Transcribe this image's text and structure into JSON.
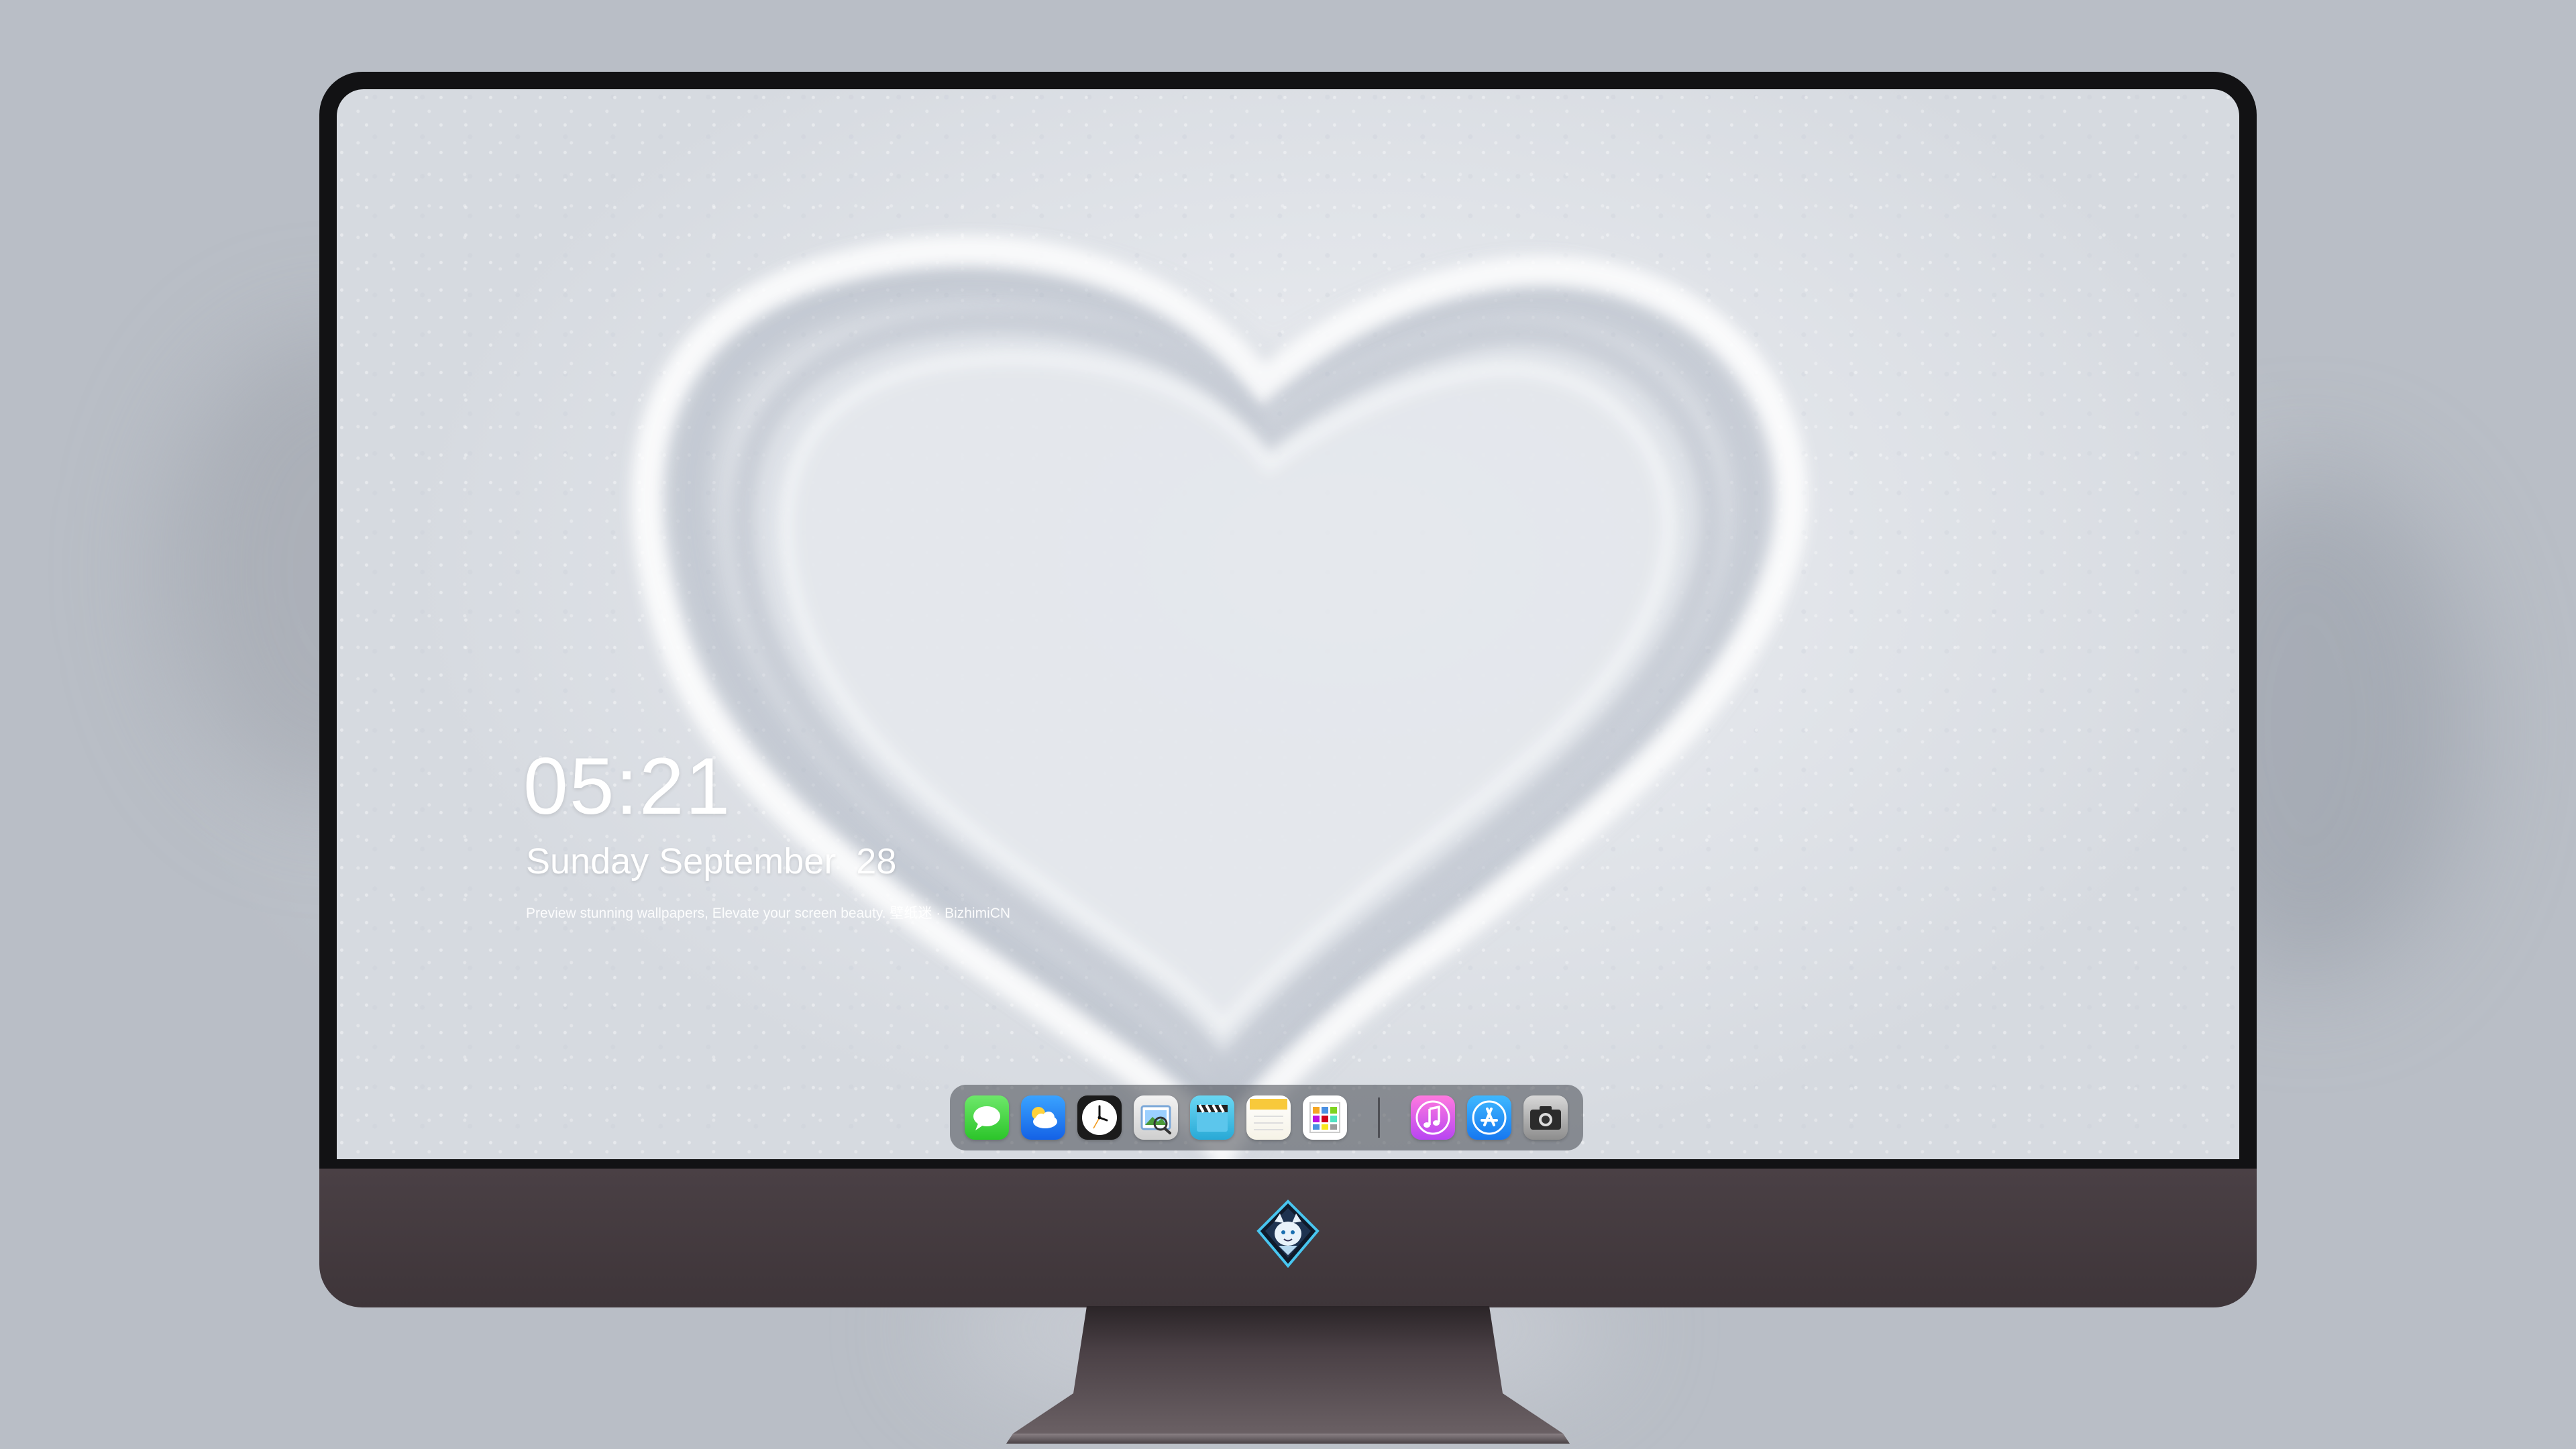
{
  "lockscreen": {
    "time": "05:21",
    "date": "Sunday September  28",
    "tagline": "Preview stunning wallpapers, Elevate your screen beauty. 壁纸迷 · BizhimiCN"
  },
  "dock": {
    "apps": [
      {
        "name": "Messages",
        "icon": "messages-icon"
      },
      {
        "name": "Weather",
        "icon": "weather-icon"
      },
      {
        "name": "Clock",
        "icon": "clock-icon"
      },
      {
        "name": "Preview",
        "icon": "preview-icon"
      },
      {
        "name": "Clips",
        "icon": "clapperboard-icon"
      },
      {
        "name": "Notes",
        "icon": "notes-icon"
      },
      {
        "name": "Calendar",
        "icon": "calendar-icon"
      },
      {
        "name": "Music",
        "icon": "music-note-icon"
      },
      {
        "name": "App Store",
        "icon": "app-store-icon"
      },
      {
        "name": "Camera",
        "icon": "camera-icon"
      }
    ]
  },
  "monitor": {
    "chin_logo": "fox-mascot-logo",
    "colors": {
      "bezel": "#121214",
      "chin": "#453b40",
      "snow": "#e4e7ec"
    }
  }
}
